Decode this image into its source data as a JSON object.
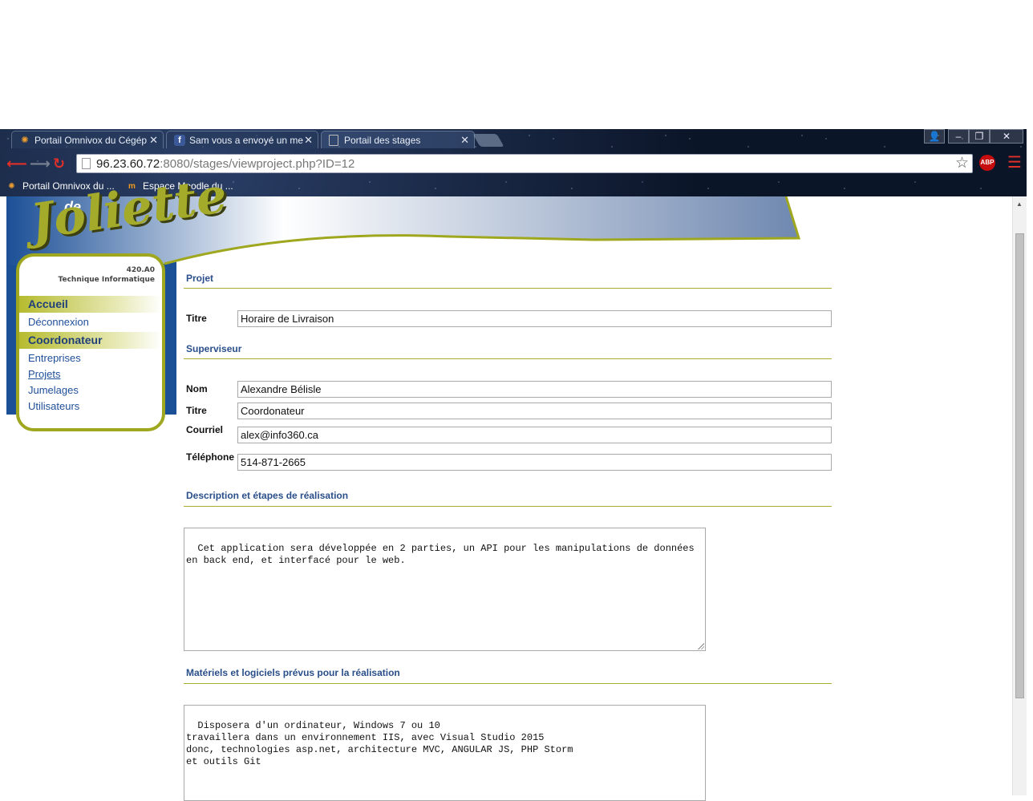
{
  "browser": {
    "tabs": [
      {
        "title": "Portail Omnivox du Cégép",
        "icon": "omnivox-icon",
        "active": false
      },
      {
        "title": "Sam vous a envoyé un me",
        "icon": "facebook-icon",
        "active": false
      },
      {
        "title": "Portail des stages",
        "icon": "page-icon",
        "active": true
      }
    ],
    "url_host": "96.23.60.72",
    "url_rest": ":8080/stages/viewproject.php?ID=12",
    "bookmarks": [
      {
        "label": "Portail Omnivox du ..."
      },
      {
        "label": "Espace Moodle du ..."
      }
    ],
    "abp_label": "ABP"
  },
  "banner": {
    "title_small": "de",
    "title_big": "Joliette"
  },
  "sidebar": {
    "dept_code": "420.A0",
    "dept_name": "Technique Informatique",
    "sections": [
      {
        "heading": "Accueil",
        "links": [
          "Déconnexion"
        ]
      },
      {
        "heading": "Coordonateur",
        "links": [
          "Entreprises",
          "Projets",
          "Jumelages",
          "Utilisateurs"
        ]
      }
    ]
  },
  "form": {
    "projet": {
      "title": "Projet",
      "titre_label": "Titre",
      "titre_value": "Horaire de Livraison"
    },
    "superviseur": {
      "title": "Superviseur",
      "nom_label": "Nom",
      "nom_value": "Alexandre Bélisle",
      "titre_label": "Titre",
      "titre_value": "Coordonateur",
      "courriel_label": "Courriel",
      "courriel_value": "alex@info360.ca",
      "telephone_label": "Téléphone",
      "telephone_value": "514-871-2665"
    },
    "description": {
      "title": "Description et étapes de réalisation",
      "text": "Cet application sera développée en 2 parties, un API pour les manipulations de données\nen back end, et interfacé pour le web."
    },
    "materiels": {
      "title": "Matériels et logiciels prévus pour la réalisation",
      "text": "Disposera d'un ordinateur, Windows 7 ou 10\ntravaillera dans un environnement IIS, avec Visual Studio 2015\ndonc, technologies asp.net, architecture MVC, ANGULAR JS, PHP Storm\net outils Git"
    }
  },
  "colors": {
    "accent_olive": "#9ea71e",
    "link_blue": "#1f4f9a",
    "heading_blue": "#2a4f8a",
    "banner_blue": "#1b4f96"
  }
}
